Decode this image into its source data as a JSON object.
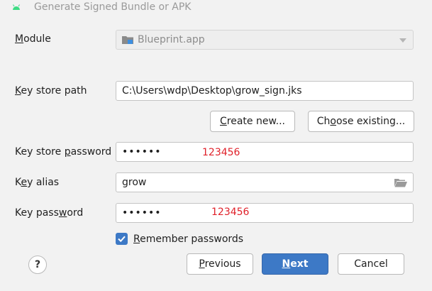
{
  "window": {
    "title": "Generate Signed Bundle or APK",
    "icon": "android-icon"
  },
  "module": {
    "label_pre": "",
    "label_key": "M",
    "label_post": "odule",
    "value": "Blueprint.app",
    "icon": "module-folder-icon"
  },
  "key_store_path": {
    "label_pre": "",
    "label_key": "K",
    "label_post": "ey store path",
    "value": "C:\\Users\\wdp\\Desktop\\grow_sign.jks"
  },
  "buttons": {
    "create_new_key": "C",
    "create_new_rest": "reate new...",
    "choose_existing_pre": "Ch",
    "choose_existing_key": "o",
    "choose_existing_post": "ose existing...",
    "previous_key": "P",
    "previous_rest": "revious",
    "next_key": "N",
    "next_rest": "ext",
    "cancel": "Cancel",
    "help": "?"
  },
  "key_store_password": {
    "label_pre": "Key store ",
    "label_key": "p",
    "label_post": "assword",
    "masked": "••••••",
    "annotation": "123456"
  },
  "key_alias": {
    "label_pre": "K",
    "label_key": "e",
    "label_post": "y alias",
    "value": "grow"
  },
  "key_password": {
    "label_pre": "Key pass",
    "label_key": "w",
    "label_post": "ord",
    "masked": "••••••",
    "annotation": "123456"
  },
  "remember": {
    "checked": true,
    "label_key": "R",
    "label_rest": "emember passwords"
  },
  "colors": {
    "accent": "#3d79c6",
    "annotation": "#e0212a",
    "background": "#f2f2f2"
  }
}
